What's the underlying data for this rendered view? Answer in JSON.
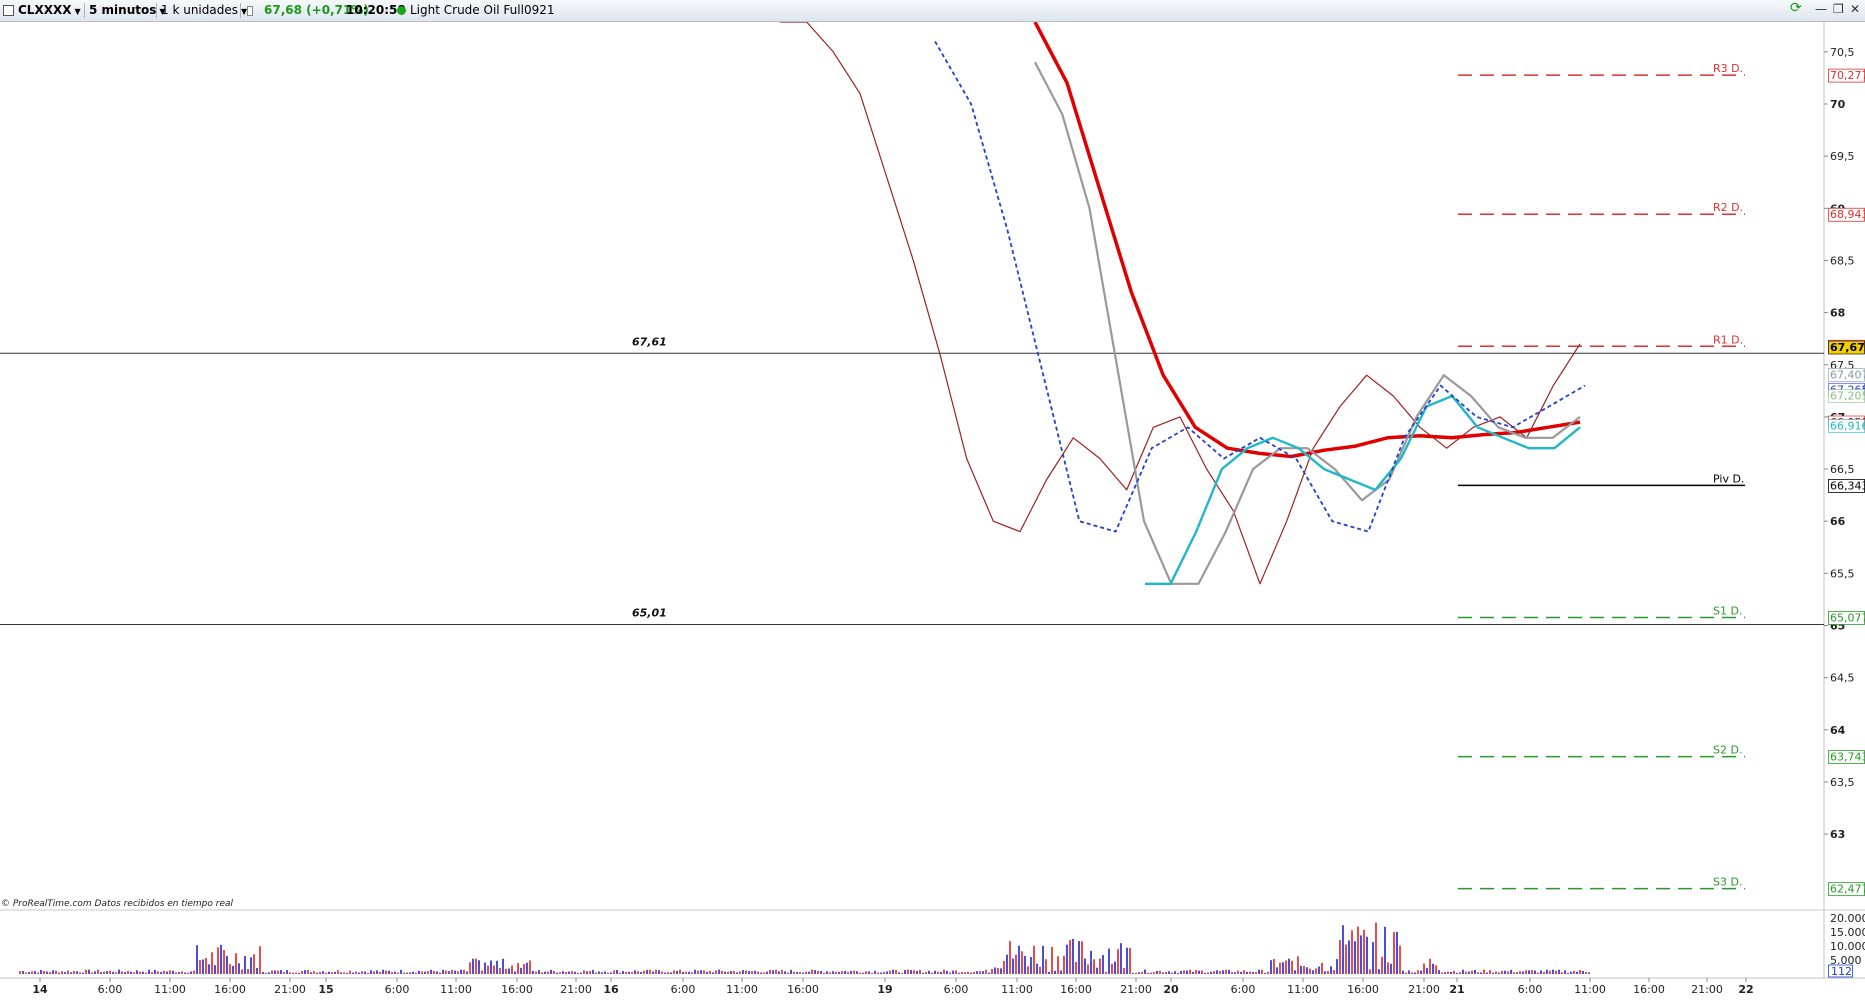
{
  "toolbar": {
    "instrument_icon": "square-icon",
    "symbol": "CLXXXX",
    "timeframe": "5 minutos",
    "units": "1 k unidades",
    "info_icon": "info-icon",
    "last_price": "67,68",
    "change": "(+0,71%)",
    "time": "10:20:58",
    "status_dot_color": "#1aa51a",
    "description": "Light Crude Oil Full0921",
    "refresh_icon": "refresh-icon",
    "minimize_icon": "minimize-icon",
    "restore_icon": "restore-icon",
    "close_icon": "close-icon"
  },
  "price_axis": {
    "ticks": [
      "70,5",
      "70",
      "69,5",
      "69",
      "68,5",
      "68",
      "67,5",
      "67",
      "66,5",
      "66",
      "65,5",
      "65",
      "64,5",
      "64",
      "63,5",
      "63"
    ]
  },
  "pivots": [
    {
      "label": "R3 D.",
      "value": "70,277",
      "price": 70.277,
      "color": "#e03030",
      "style": "dashed"
    },
    {
      "label": "R2 D.",
      "value": "68,943",
      "price": 68.943,
      "color": "#e03030",
      "style": "dashed"
    },
    {
      "label": "R1 D.",
      "value": "67,677",
      "price": 67.677,
      "color": "#e03030",
      "style": "dashed"
    },
    {
      "label": "Piv D.",
      "value": "66,343",
      "price": 66.343,
      "color": "#000000",
      "style": "solid"
    },
    {
      "label": "S1 D.",
      "value": "65,077",
      "price": 65.077,
      "color": "#2a9a2a",
      "style": "dashed"
    },
    {
      "label": "S2 D.",
      "value": "63,743",
      "price": 63.743,
      "color": "#2a9a2a",
      "style": "dashed"
    },
    {
      "label": "S3 D.",
      "value": "62,477",
      "price": 62.477,
      "color": "#2a9a2a",
      "style": "dashed"
    }
  ],
  "horizontal_lines": [
    {
      "label": "67,61",
      "price": 67.61
    },
    {
      "label": "65,01",
      "price": 65.01
    }
  ],
  "value_tags": [
    {
      "text": "67,67",
      "price": 67.67,
      "color": "#000000",
      "bg": "#f0d000"
    },
    {
      "text": "67,407",
      "price": 67.407,
      "color": "#8a9aa8",
      "bg": "#ffffff"
    },
    {
      "text": "67,265",
      "price": 67.265,
      "color": "#2040d0",
      "bg": "#ffffff"
    },
    {
      "text": "67,205",
      "price": 67.205,
      "color": "#88c088",
      "bg": "#ffffff"
    },
    {
      "text": "66,951",
      "price": 66.951,
      "color": "#e00000",
      "bg": "#ffffff"
    },
    {
      "text": "66,916",
      "price": 66.916,
      "color": "#20b8c8",
      "bg": "#ffffff"
    }
  ],
  "credit": "© ProRealTime.com  Datos recibidos en tiempo real",
  "volume_axis": {
    "ticks": [
      {
        "label": "20.000",
        "value": 20000
      },
      {
        "label": "15.000",
        "value": 15000
      },
      {
        "label": "10.000",
        "value": 10000
      },
      {
        "label": "5.000",
        "value": 5000
      }
    ],
    "current": "112"
  },
  "time_axis": [
    {
      "label": "14",
      "bold": true
    },
    {
      "label": "6:00"
    },
    {
      "label": "11:00"
    },
    {
      "label": "16:00"
    },
    {
      "label": "21:00"
    },
    {
      "label": "15",
      "bold": true
    },
    {
      "label": "6:00"
    },
    {
      "label": "11:00"
    },
    {
      "label": "16:00"
    },
    {
      "label": "21:00"
    },
    {
      "label": "16",
      "bold": true
    },
    {
      "label": "6:00"
    },
    {
      "label": "11:00"
    },
    {
      "label": "16:00"
    },
    {
      "label": "19",
      "bold": true
    },
    {
      "label": "6:00"
    },
    {
      "label": "11:00"
    },
    {
      "label": "16:00"
    },
    {
      "label": "21:00"
    },
    {
      "label": "20",
      "bold": true
    },
    {
      "label": "6:00"
    },
    {
      "label": "11:00"
    },
    {
      "label": "16:00"
    },
    {
      "label": "21:00"
    },
    {
      "label": "21",
      "bold": true
    },
    {
      "label": "6:00"
    },
    {
      "label": "11:00"
    },
    {
      "label": "16:00"
    },
    {
      "label": "21:00"
    },
    {
      "label": "22",
      "bold": true
    }
  ],
  "chart_data": {
    "type": "line",
    "y_range": [
      62.3,
      70.7
    ],
    "series": [
      {
        "color": "#a02020",
        "values": [
          70.9,
          70.8,
          70.5,
          70.1,
          69.3,
          68.5,
          67.6,
          66.6,
          66.0,
          65.9,
          66.4,
          66.8,
          66.6,
          66.3,
          66.9,
          67.0,
          66.5,
          66.1,
          65.4,
          66.0,
          66.7,
          67.1,
          67.4,
          67.2,
          66.9,
          66.7,
          66.9,
          67.0,
          66.8,
          67.3,
          67.7
        ]
      },
      {
        "color": "#e00000",
        "values": [
          70.8,
          70.2,
          69.2,
          68.2,
          67.4,
          66.9,
          66.7,
          66.65,
          66.62,
          66.68,
          66.72,
          66.8,
          66.82,
          66.8,
          66.83,
          66.85,
          66.9,
          66.95
        ]
      },
      {
        "color": "#999999",
        "values": [
          70.4,
          69.9,
          69.0,
          67.5,
          66.0,
          65.4,
          65.4,
          65.9,
          66.5,
          66.7,
          66.7,
          66.5,
          66.2,
          66.4,
          67.0,
          67.4,
          67.2,
          66.9,
          66.8,
          66.8,
          67.0
        ]
      },
      {
        "color": "#20b8c8",
        "values": [
          65.4,
          65.4,
          65.9,
          66.5,
          66.7,
          66.8,
          66.7,
          66.5,
          66.4,
          66.3,
          66.6,
          67.1,
          67.2,
          66.9,
          66.8,
          66.7,
          66.7,
          66.9
        ]
      },
      {
        "color": "#2040d0",
        "values": [
          70.6,
          70.0,
          68.8,
          67.4,
          66.0,
          65.9,
          66.7,
          66.9,
          66.6,
          66.8,
          66.6,
          66.0,
          65.9,
          66.8,
          67.3,
          67.0,
          66.9,
          67.1,
          67.3
        ]
      }
    ],
    "volume_peak": 19000
  }
}
